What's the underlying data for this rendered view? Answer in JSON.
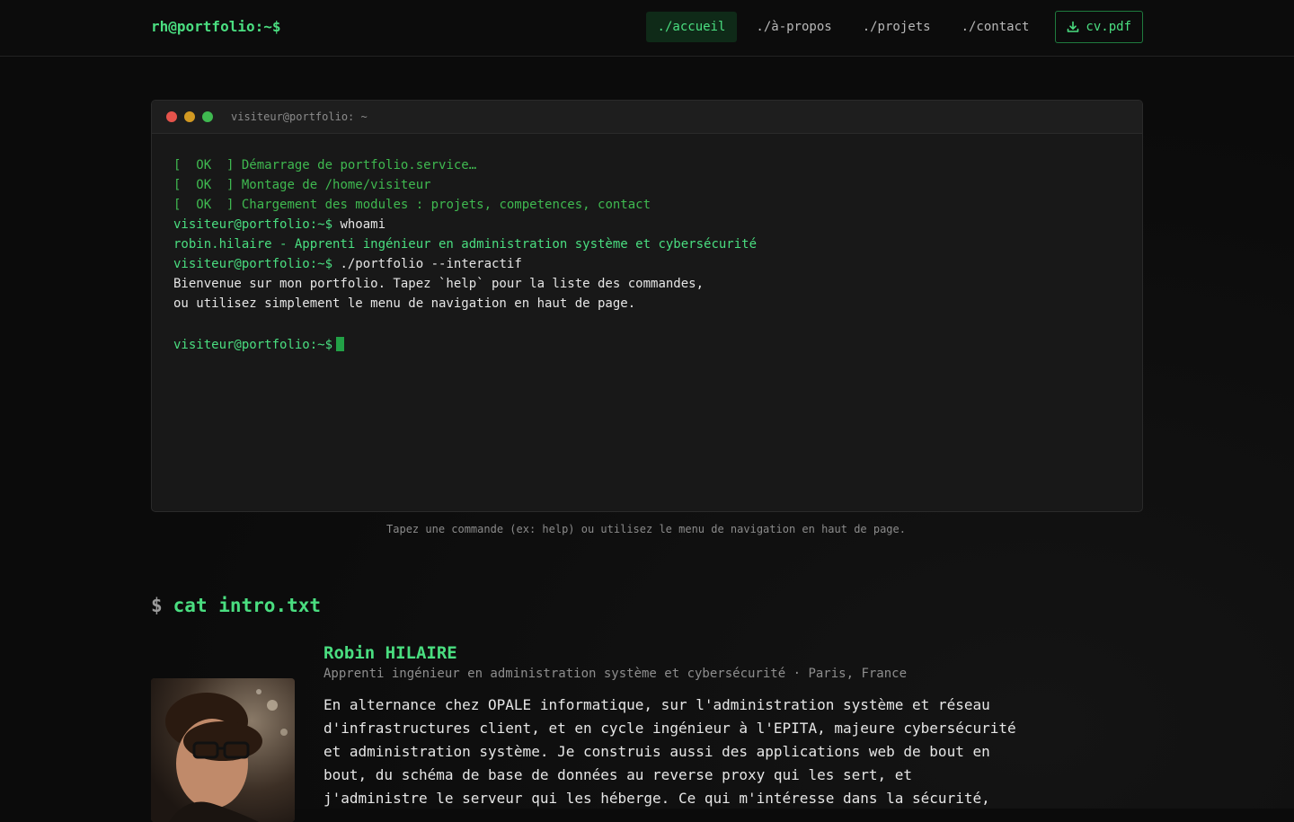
{
  "header": {
    "brand": "rh@portfolio:~$",
    "nav": [
      {
        "label": "./accueil",
        "active": true
      },
      {
        "label": "./à-propos",
        "active": false
      },
      {
        "label": "./projets",
        "active": false
      },
      {
        "label": "./contact",
        "active": false
      }
    ],
    "cv_label": "cv.pdf",
    "cv_icon": "download-icon"
  },
  "terminal": {
    "title": "visiteur@portfolio: ~",
    "boot": [
      {
        "status": "[  OK  ]",
        "message": "Démarrage de portfolio.service…"
      },
      {
        "status": "[  OK  ]",
        "message": "Montage de /home/visiteur"
      },
      {
        "status": "[  OK  ]",
        "message": "Chargement des modules : projets, competences, contact"
      }
    ],
    "prompt": "visiteur@portfolio:~$",
    "cmd1": "whoami",
    "out1": "robin.hilaire - Apprenti ingénieur en administration système et cybersécurité",
    "cmd2": "./portfolio --interactif",
    "out2_line1": "Bienvenue sur mon portfolio. Tapez `help` pour la liste des commandes,",
    "out2_line2": "ou utilisez simplement le menu de navigation en haut de page."
  },
  "hint": "Tapez une commande (ex: help) ou utilisez le menu de navigation en haut de page.",
  "intro": {
    "prompt_symbol": "$",
    "command": "cat intro.txt",
    "name": "Robin HILAIRE",
    "subtitle": "Apprenti ingénieur en administration système et cybersécurité · Paris, France",
    "bio_lines": [
      "En alternance chez OPALE informatique, sur l'administration système et réseau",
      "d'infrastructures client, et en cycle ingénieur à l'EPITA, majeure cybersécurité",
      "et administration système. Je construis aussi des applications web de bout en",
      "bout, du schéma de base de données au reverse proxy qui les sert, et",
      "j'administre le serveur qui les héberge. Ce qui m'intéresse dans la sécurité,"
    ]
  },
  "colors": {
    "accent": "#4ade80",
    "background": "#0b0b0b",
    "terminal_bg": "#181818"
  }
}
